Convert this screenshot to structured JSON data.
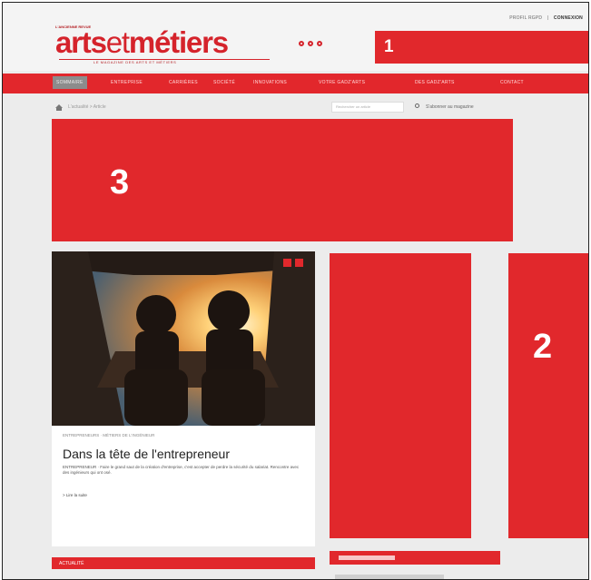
{
  "header": {
    "top_links": [
      "PROFIL RGPD",
      "CONNEXION"
    ],
    "logo_supertitle": "L'ANCIENNE REVUE",
    "logo_text": "arts",
    "logo_text_et": "et",
    "logo_text_metiers": "métiers",
    "logo_tagline": "LE MAGAZINE DES ARTS ET MÉTIERS",
    "block_1_label": "1"
  },
  "nav": {
    "items": [
      "SOMMAIRE",
      "ENTREPRISE",
      "CARRIÈRES",
      "SOCIÉTÉ",
      "INNOVATIONS",
      "VOTRE GADZ'ARTS",
      "DES GADZ'ARTS",
      "CONTACT"
    ]
  },
  "breadcrumb": {
    "path": "L'actualité > Article",
    "search_placeholder": "Rechercher un article",
    "subscribe_link": "S'abonner au magazine"
  },
  "ads": {
    "block_2_label": "2",
    "block_3_label": "3"
  },
  "featured": {
    "category": "ENTREPRENEURS · MÉTIERS DE L'INGÉNIEUR",
    "title": "Dans la tête de l'entrepreneur",
    "description": "ENTREPRENEUR · Faire le grand saut de la création d'entreprise, c'est accepter de perdre la sécurité du salariat. Rencontre avec des ingénieurs qui ont osé.",
    "read_more": "> Lire la suite"
  },
  "sections": {
    "actu_label": "ACTUALITÉ"
  },
  "colors": {
    "brand_red": "#e1282c",
    "nav_active": "#8c8c8c"
  }
}
